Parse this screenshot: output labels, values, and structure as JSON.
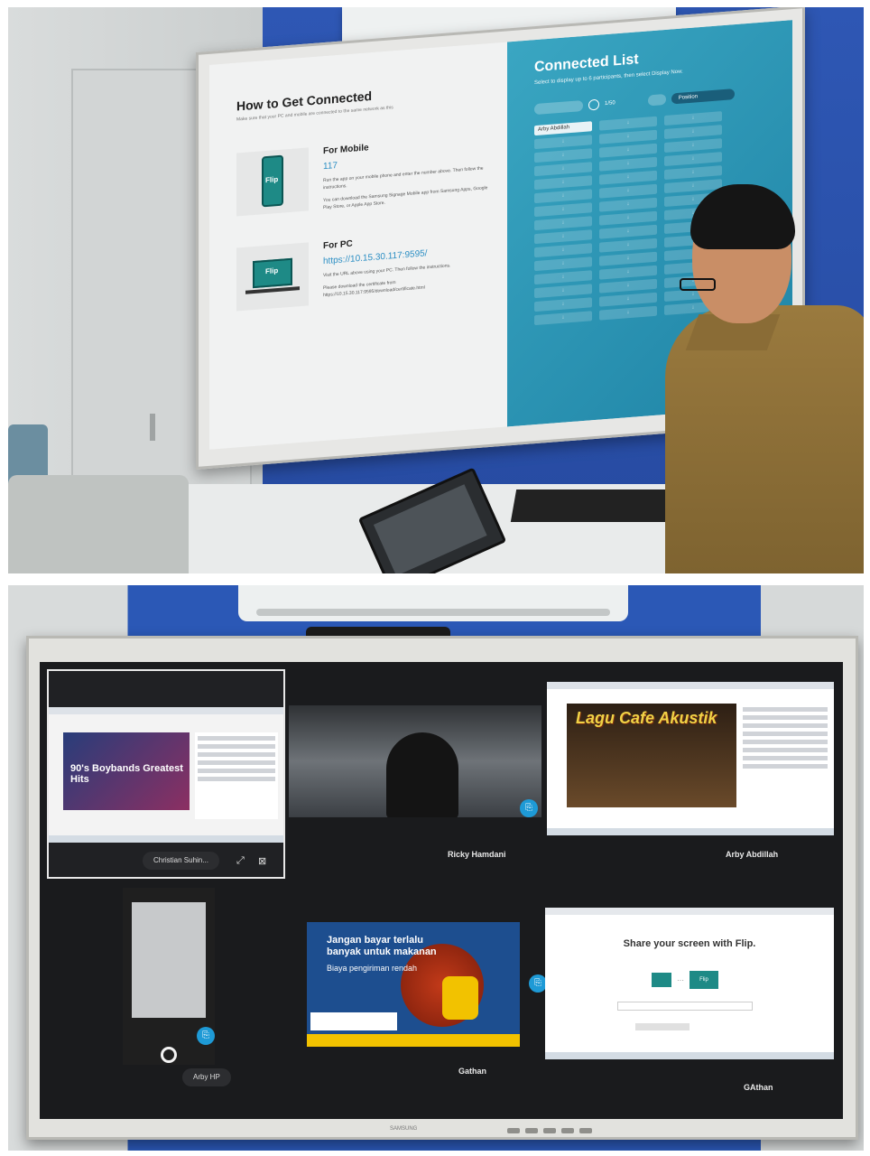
{
  "top_photo": {
    "screen": {
      "guide": {
        "title": "How to Get Connected",
        "subtitle": "Make sure that your PC and mobile are connected to the same network as this",
        "mobile": {
          "heading": "For Mobile",
          "code": "117",
          "body": "Run the app on your mobile phone and enter the number above. Then follow the instructions.",
          "note": "You can download the Samsung Signage Mobile app from Samsung Apps, Google Play Store, or Apple App Store.",
          "thumb_label": "Flip"
        },
        "pc": {
          "heading": "For PC",
          "url": "https://10.15.30.117:9595/",
          "body": "Visit the URL above using your PC. Then follow the instructions.",
          "note": "Please download the certificate from https://10.15.30.117:9595/download/certificate.html",
          "thumb_label": "Flip"
        }
      },
      "list": {
        "title": "Connected List",
        "subtitle": "Select to display up to 6 participants, then select Display Now.",
        "count": "1/50",
        "sort_label": "Position",
        "first_entry": "Arby Abdillah"
      }
    }
  },
  "bottom_photo": {
    "tiles": [
      {
        "label": "Christian Suhin...",
        "banner": "90's Boybands Greatest Hits"
      },
      {
        "label": "Ricky Hamdani"
      },
      {
        "label": "Arby Abdillah",
        "banner": "Lagu Cafe Akustik"
      },
      {
        "label": "Arby HP"
      },
      {
        "label": "Gathan",
        "headline": "Jangan bayar terlalu banyak untuk makanan",
        "sub": "Biaya pengiriman rendah"
      },
      {
        "label": "GAthan",
        "headline": "Share your screen with Flip.",
        "button": "Flip"
      }
    ],
    "monitor_brand": "SAMSUNG"
  }
}
